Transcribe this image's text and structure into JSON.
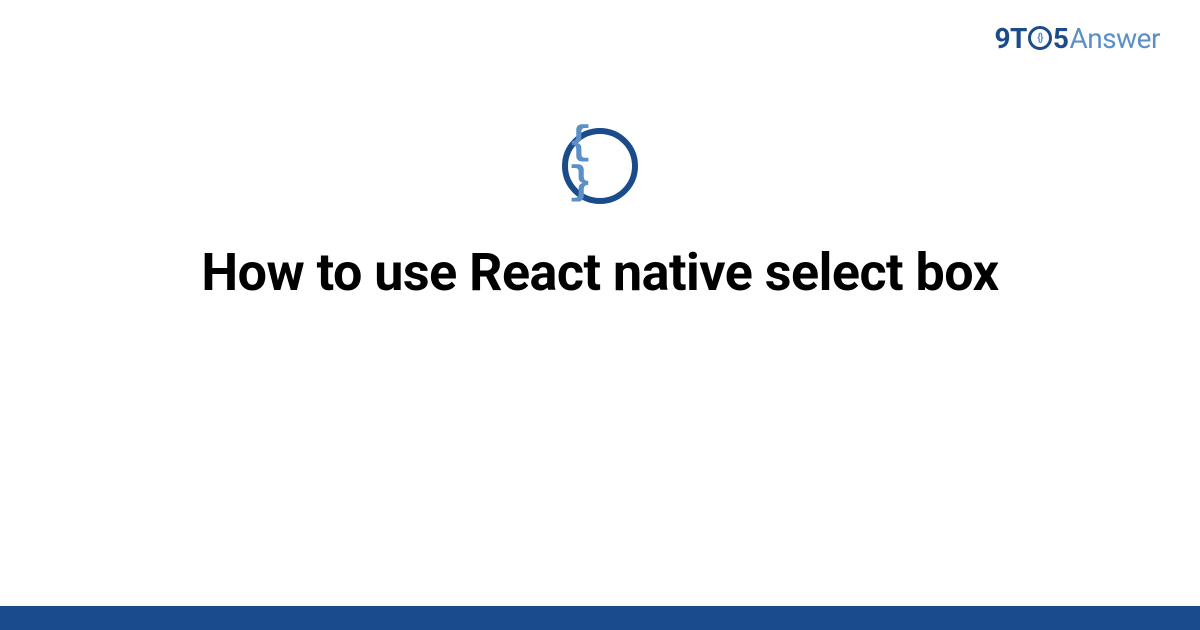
{
  "brand": {
    "prefix": "9T",
    "circle_inner": "{}",
    "five": "5",
    "suffix": "Answer"
  },
  "icon": {
    "braces": "{ }"
  },
  "title": "How to use React native select box",
  "colors": {
    "primary": "#1a4c8b",
    "accent": "#5a8fc7"
  }
}
